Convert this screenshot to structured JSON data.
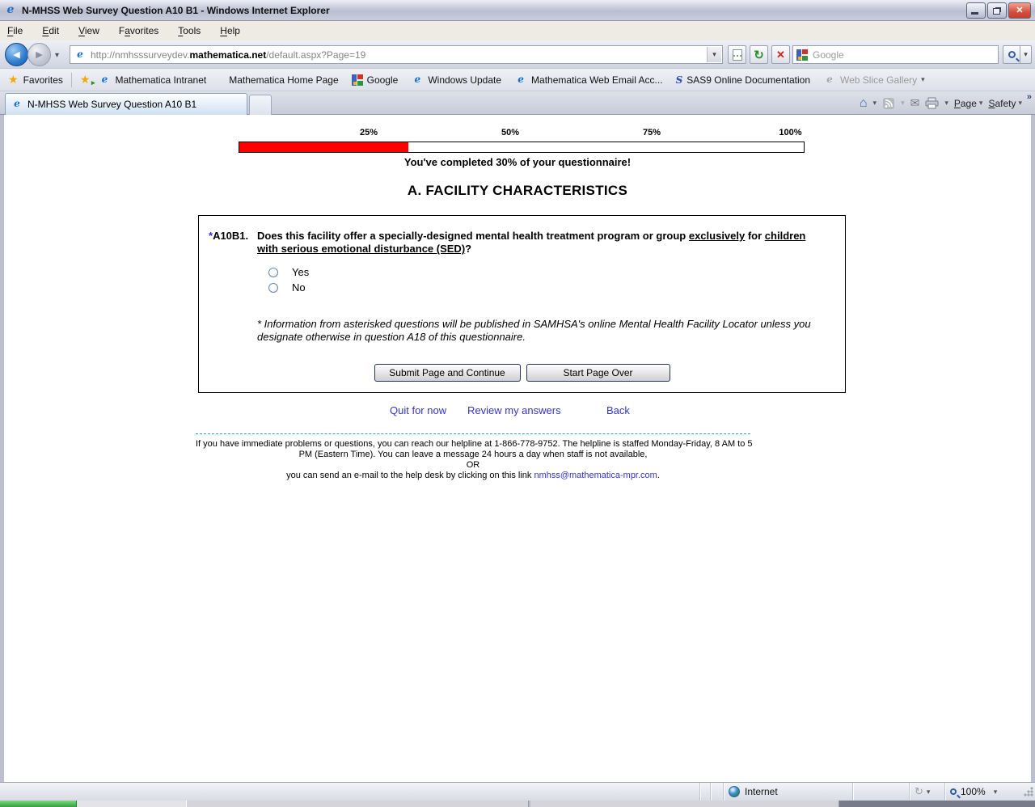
{
  "window": {
    "title": "N-MHSS Web Survey Question A10 B1 - Windows Internet Explorer"
  },
  "icons": {
    "back": "◀",
    "forward": "▶",
    "caret": "▾",
    "refresh": "↻",
    "stop": "✕",
    "close": "✕",
    "favorites_star": "★",
    "add_favorite_star": "★",
    "add_favorite_arrow": "▸",
    "home": "⌂",
    "mail": "✉",
    "chevron_more": "»",
    "ie_logo": "e",
    "sas_logo": "S",
    "protected_mode": "↻"
  },
  "menu_bar": {
    "items": [
      {
        "key": "F",
        "post": "ile"
      },
      {
        "key": "E",
        "post": "dit"
      },
      {
        "key": "V",
        "post": "iew"
      },
      {
        "pre": "F",
        "key": "a",
        "post": "vorites"
      },
      {
        "key": "T",
        "post": "ools"
      },
      {
        "key": "H",
        "post": "elp"
      }
    ]
  },
  "address_bar": {
    "url_pre": "http://nmhsssurveydev.",
    "url_domain": "mathematica.net",
    "url_post": "/default.aspx?Page=19",
    "search_placeholder": "Google"
  },
  "favorites_bar": {
    "label": "Favorites",
    "links": [
      {
        "label": "Mathematica Intranet"
      },
      {
        "label": "Mathematica Home Page"
      },
      {
        "label": "Google"
      },
      {
        "label": "Windows Update"
      },
      {
        "label": "Mathematica Web Email Acc..."
      },
      {
        "label": "SAS9 Online Documentation"
      },
      {
        "label": "Web Slice Gallery"
      }
    ]
  },
  "tab_bar": {
    "active_tab": "N-MHSS Web Survey Question A10 B1",
    "commands": [
      {
        "key": "P",
        "post": "age"
      },
      {
        "key": "S",
        "post": "afety"
      }
    ]
  },
  "survey": {
    "progress": {
      "ticks": [
        "25%",
        "50%",
        "75%",
        "100%"
      ],
      "percent_complete": 30,
      "fill_color": "#ff0000",
      "message": "You've completed 30% of your questionnaire!"
    },
    "section_title": "A. FACILITY CHARACTERISTICS",
    "question": {
      "asterisk": "*",
      "number": "A10B1.",
      "line1_text": "Does this facility offer a specially-designed mental health treatment program or group ",
      "line1_underline1": "exclusively",
      "line1_mid": " for ",
      "line1_underline2": "children",
      "line2_underline": "with serious emotional disturbance (SED)",
      "line2_end": "?"
    },
    "options": [
      {
        "label": "Yes"
      },
      {
        "label": "No"
      }
    ],
    "note": "* Information from asterisked questions will be published in SAMHSA's online Mental Health Facility Locator unless you designate otherwise in question A18 of this questionnaire.",
    "buttons": {
      "submit": "Submit Page and Continue",
      "start_over": "Start Page Over"
    },
    "nav_links": [
      {
        "label": "Quit for now"
      },
      {
        "label": "Review my answers"
      },
      {
        "label": "Back"
      }
    ],
    "footer": {
      "line1": "If you have immediate problems or questions, you can reach our helpline at 1-866-778-9752. The helpline is staffed Monday-Friday, 8 AM to 5",
      "line2": "PM (Eastern Time). You can leave a message 24 hours a day when staff is not available,",
      "or_label": "OR",
      "line3_pre": "you can send an e-mail to the help desk by clicking on this link ",
      "email_link": "nmhss@mathematica-mpr.com",
      "line3_post": "."
    }
  },
  "status_bar": {
    "zone": "Internet",
    "zoom_level": "100%"
  },
  "colors": {
    "progress_fill": "#ff0000",
    "link": "#3333cc",
    "divider_dash": "#35a2a2",
    "asterisk_blue": "#3333cc"
  }
}
